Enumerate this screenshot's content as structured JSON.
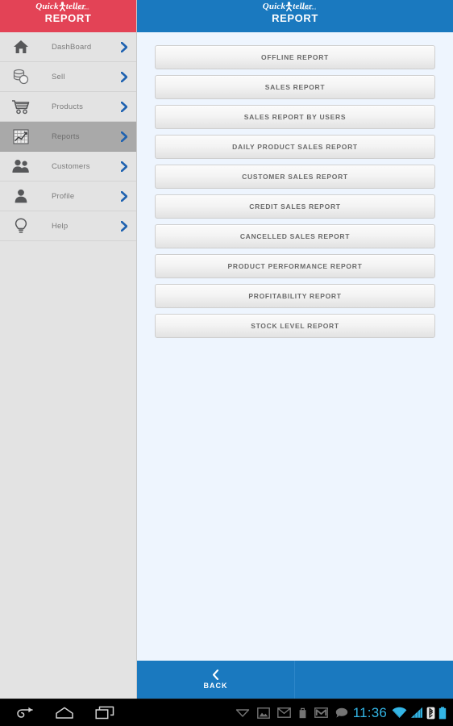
{
  "brand": {
    "logo_text_1": "Quick",
    "logo_text_2": "teller",
    "logo_tm": "PayDirect",
    "red": "#e34356",
    "blue": "#1a79bf",
    "accent_cyan": "#33b5e5"
  },
  "sidebar": {
    "header_title": "REPORT",
    "items": [
      {
        "label": "DashBoard",
        "icon": "home-icon",
        "active": false
      },
      {
        "label": "Sell",
        "icon": "coins-icon",
        "active": false
      },
      {
        "label": "Products",
        "icon": "cart-icon",
        "active": false
      },
      {
        "label": "Reports",
        "icon": "chart-icon",
        "active": true
      },
      {
        "label": "Customers",
        "icon": "users-icon",
        "active": false
      },
      {
        "label": "Profile",
        "icon": "user-icon",
        "active": false
      },
      {
        "label": "Help",
        "icon": "bulb-icon",
        "active": false
      }
    ]
  },
  "main": {
    "header_title": "REPORT",
    "report_buttons": [
      {
        "label": "OFFLINE REPORT"
      },
      {
        "label": "SALES REPORT"
      },
      {
        "label": "SALES REPORT BY USERS"
      },
      {
        "label": "DAILY PRODUCT SALES REPORT"
      },
      {
        "label": "CUSTOMER SALES REPORT"
      },
      {
        "label": "CREDIT SALES REPORT"
      },
      {
        "label": "CANCELLED SALES REPORT"
      },
      {
        "label": "PRODUCT PERFORMANCE REPORT"
      },
      {
        "label": "PROFITABILITY REPORT"
      },
      {
        "label": "STOCK LEVEL REPORT"
      }
    ],
    "footer": {
      "back_label": "BACK"
    }
  },
  "system_bar": {
    "nav_keys": [
      {
        "name": "back-icon"
      },
      {
        "name": "home-icon"
      },
      {
        "name": "recent-apps-icon"
      }
    ],
    "notification_icons": [
      {
        "name": "chevron-down-icon"
      },
      {
        "name": "gallery-icon"
      },
      {
        "name": "email-icon"
      },
      {
        "name": "bag-icon"
      },
      {
        "name": "gmail-icon"
      },
      {
        "name": "message-icon"
      }
    ],
    "time": "11:36",
    "status_icons": [
      {
        "name": "wifi-icon"
      },
      {
        "name": "signal-icon"
      },
      {
        "name": "bluetooth-icon"
      },
      {
        "name": "battery-icon"
      }
    ]
  }
}
